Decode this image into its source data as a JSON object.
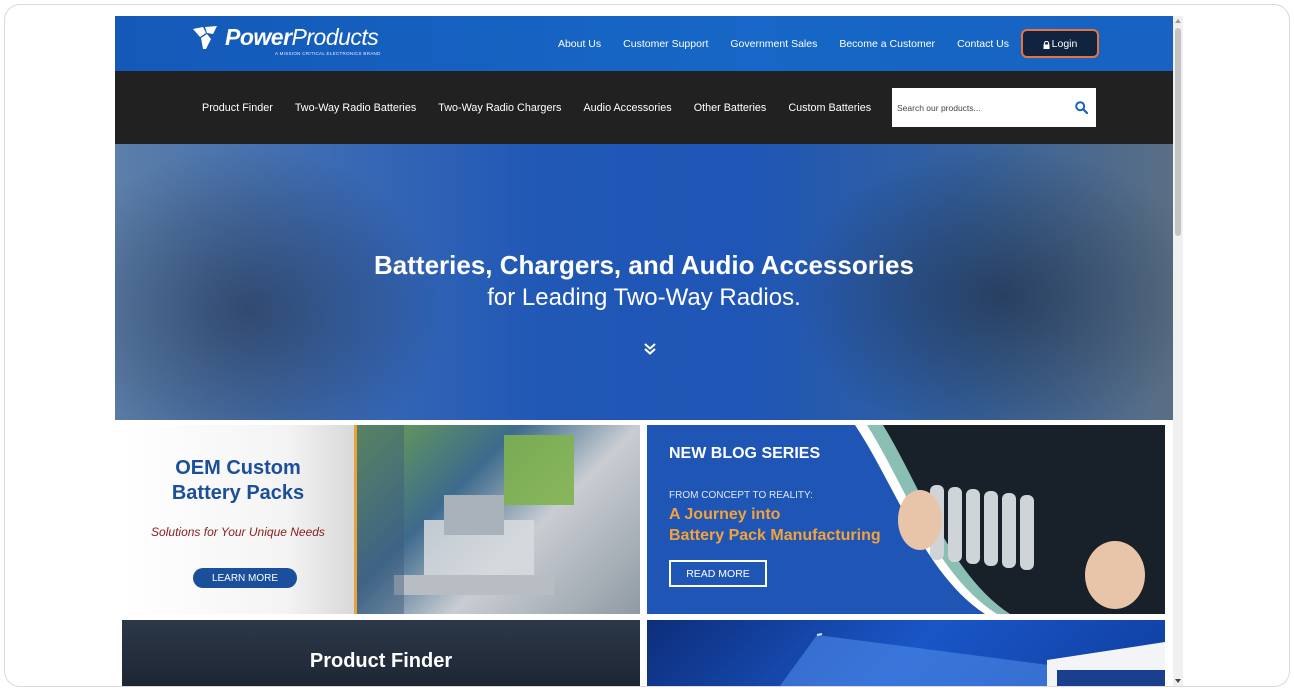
{
  "brand": {
    "name_bold": "Power",
    "name_light": "Products",
    "tagline": "A MISSION CRITICAL ELECTRONICS BRAND"
  },
  "top_nav": {
    "links": [
      "About Us",
      "Customer Support",
      "Government Sales",
      "Become a Customer",
      "Contact Us"
    ],
    "login_label": "Login"
  },
  "main_nav": {
    "links": [
      "Product Finder",
      "Two-Way Radio Batteries",
      "Two-Way Radio Chargers",
      "Audio Accessories",
      "Other Batteries",
      "Custom Batteries"
    ],
    "search_placeholder": "Search our products..."
  },
  "hero": {
    "headline": "Batteries, Chargers, and Audio Accessories",
    "subheadline": "for Leading Two-Way Radios."
  },
  "promo_oem": {
    "title_line1": "OEM Custom",
    "title_line2": "Battery Packs",
    "subtitle": "Solutions for Your Unique Needs",
    "button": "LEARN MORE"
  },
  "promo_blog": {
    "title": "NEW BLOG SERIES",
    "small": "FROM CONCEPT TO REALITY:",
    "highlight_line1": "A Journey into",
    "highlight_line2": "Battery Pack Manufacturing",
    "button": "READ MORE"
  },
  "promo_finder": {
    "title": "Product Finder"
  },
  "colors": {
    "brand_blue": "#1762c2",
    "nav_dark": "#212121",
    "accent_orange": "#e8743b",
    "highlight_orange": "#f4a23a"
  }
}
